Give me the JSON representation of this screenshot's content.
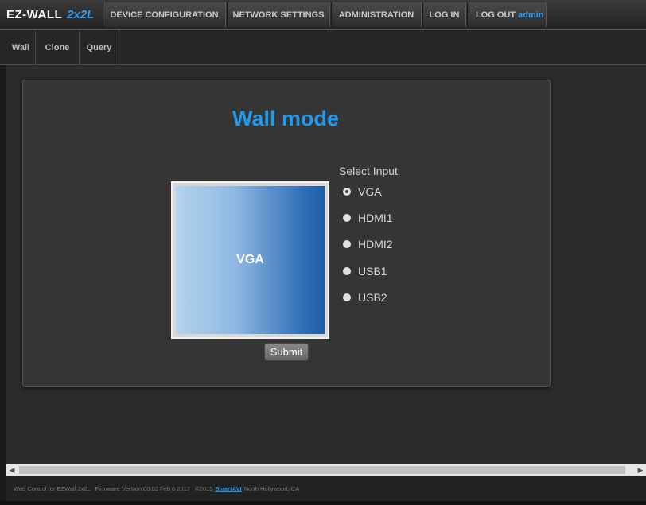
{
  "logo": {
    "part1": "EZ-WALL",
    "part2": "2x2L"
  },
  "nav": {
    "device_configuration": "DEVICE CONFIGURATION",
    "network_settings": "NETWORK SETTINGS",
    "administration": "ADMINISTRATION",
    "log_in": "LOG IN",
    "log_out": "LOG OUT",
    "username": "admin"
  },
  "subnav": [
    "Wall",
    "Clone",
    "Query"
  ],
  "main": {
    "title": "Wall mode",
    "screen_label": "VGA",
    "select_input_label": "Select Input",
    "inputs": [
      {
        "label": "VGA",
        "checked": true
      },
      {
        "label": "HDMI1",
        "checked": false
      },
      {
        "label": "HDMI2",
        "checked": false
      },
      {
        "label": "USB1",
        "checked": false
      },
      {
        "label": "USB2",
        "checked": false
      }
    ],
    "submit_label": "Submit"
  },
  "footer": {
    "text1": "Web Control for EZWall 2x2L   Firmware Version:00.02 Feb 6 2017   ©2015",
    "link": "SmartAVI",
    "text2": "North Hollywood, CA"
  },
  "colors": {
    "accent": "#1e9aef",
    "background": "#2b2b2b"
  }
}
